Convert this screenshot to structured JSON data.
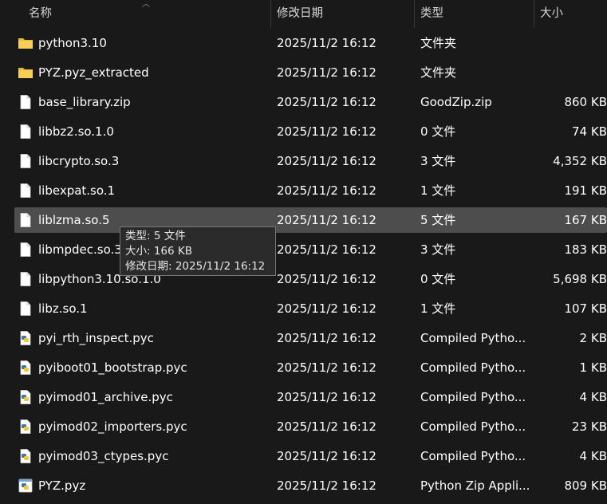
{
  "columns": {
    "name": "名称",
    "date": "修改日期",
    "type": "类型",
    "size": "大小"
  },
  "files": [
    {
      "name": "python3.10",
      "date": "2025/11/2 16:12",
      "type": "文件夹",
      "size": "",
      "icon": "folder-icon"
    },
    {
      "name": "PYZ.pyz_extracted",
      "date": "2025/11/2 16:12",
      "type": "文件夹",
      "size": "",
      "icon": "folder-icon"
    },
    {
      "name": "base_library.zip",
      "date": "2025/11/2 16:12",
      "type": "GoodZip.zip",
      "size": "860 KB",
      "icon": "file-icon"
    },
    {
      "name": "libbz2.so.1.0",
      "date": "2025/11/2 16:12",
      "type": "0 文件",
      "size": "74 KB",
      "icon": "file-icon"
    },
    {
      "name": "libcrypto.so.3",
      "date": "2025/11/2 16:12",
      "type": "3 文件",
      "size": "4,352 KB",
      "icon": "file-icon"
    },
    {
      "name": "libexpat.so.1",
      "date": "2025/11/2 16:12",
      "type": "1 文件",
      "size": "191 KB",
      "icon": "file-icon"
    },
    {
      "name": "liblzma.so.5",
      "date": "2025/11/2 16:12",
      "type": "5 文件",
      "size": "167 KB",
      "icon": "file-icon"
    },
    {
      "name": "libmpdec.so.3",
      "date": "2025/11/2 16:12",
      "type": "3 文件",
      "size": "183 KB",
      "icon": "file-icon"
    },
    {
      "name": "libpython3.10.so.1.0",
      "date": "2025/11/2 16:12",
      "type": "0 文件",
      "size": "5,698 KB",
      "icon": "file-icon"
    },
    {
      "name": "libz.so.1",
      "date": "2025/11/2 16:12",
      "type": "1 文件",
      "size": "107 KB",
      "icon": "file-icon"
    },
    {
      "name": "pyi_rth_inspect.pyc",
      "date": "2025/11/2 16:12",
      "type": "Compiled Pytho...",
      "size": "2 KB",
      "icon": "python-file-icon"
    },
    {
      "name": "pyiboot01_bootstrap.pyc",
      "date": "2025/11/2 16:12",
      "type": "Compiled Pytho...",
      "size": "1 KB",
      "icon": "python-file-icon"
    },
    {
      "name": "pyimod01_archive.pyc",
      "date": "2025/11/2 16:12",
      "type": "Compiled Pytho...",
      "size": "4 KB",
      "icon": "python-file-icon"
    },
    {
      "name": "pyimod02_importers.pyc",
      "date": "2025/11/2 16:12",
      "type": "Compiled Pytho...",
      "size": "23 KB",
      "icon": "python-file-icon"
    },
    {
      "name": "pyimod03_ctypes.pyc",
      "date": "2025/11/2 16:12",
      "type": "Compiled Pytho...",
      "size": "4 KB",
      "icon": "python-file-icon"
    },
    {
      "name": "PYZ.pyz",
      "date": "2025/11/2 16:12",
      "type": "Python Zip Appli...",
      "size": "809 KB",
      "icon": "python-zip-icon"
    }
  ],
  "hover_index": 6,
  "tooltip": {
    "type_line": "类型: 5 文件",
    "size_line": "大小: 166 KB",
    "date_line": "修改日期: 2025/11/2 16:12"
  },
  "colors": {
    "background": "#191919",
    "hover_row": "#4d4d4d",
    "folder": "#f4c542",
    "text": "#ffffff"
  }
}
